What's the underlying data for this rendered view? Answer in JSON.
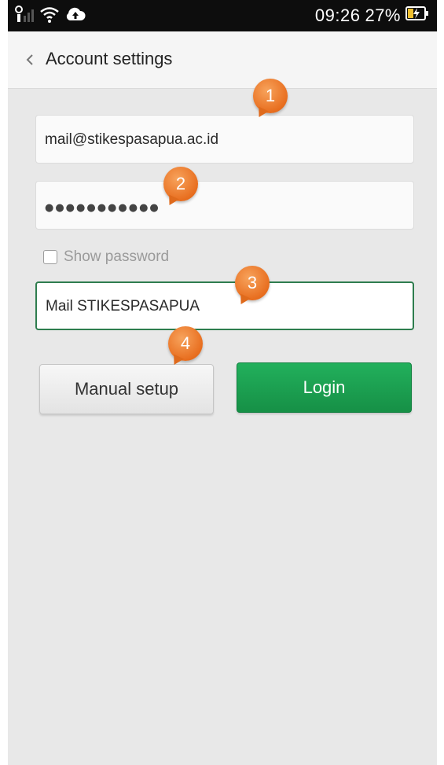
{
  "status_bar": {
    "time": "09:26",
    "battery": "27%",
    "icons": [
      "signal-icon",
      "wifi-icon",
      "cloud-upload-icon",
      "battery-charging-icon"
    ]
  },
  "action_bar": {
    "title": "Account settings",
    "back_icon": "chevron-left-icon"
  },
  "form": {
    "email_value": "mail@stikespasapua.ac.id",
    "password_value": "●●●●●●●●●●●",
    "show_password_label": "Show password",
    "show_password_checked": false,
    "account_name_value": "Mail STIKESPASAPUA"
  },
  "buttons": {
    "manual_setup_label": "Manual setup",
    "login_label": "Login"
  },
  "callouts": [
    "1",
    "2",
    "3",
    "4"
  ],
  "colors": {
    "login_green": "#1aa152",
    "callout_orange": "#e8741f",
    "active_border": "#2e7d4e"
  }
}
